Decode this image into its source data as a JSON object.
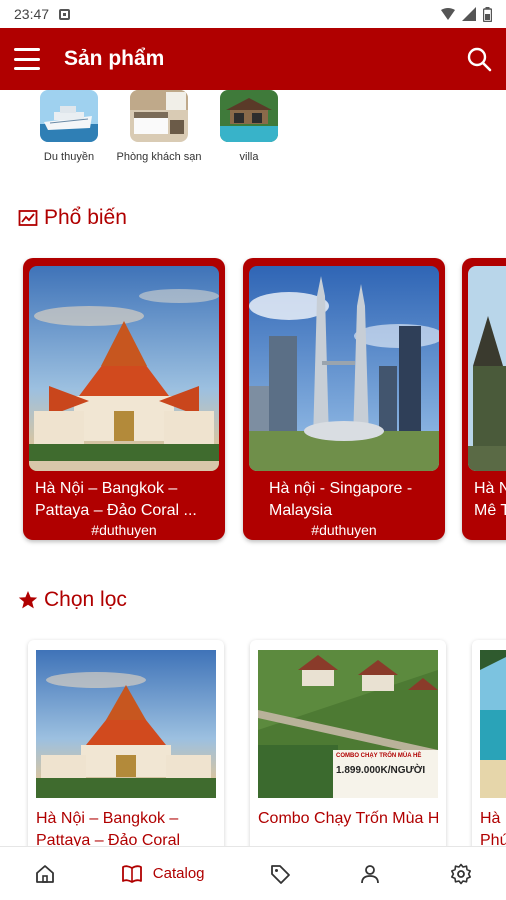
{
  "status_bar": {
    "time": "23:47"
  },
  "app_bar": {
    "title": "Sản phẩm",
    "menu_icon": "hamburger-icon",
    "search_icon": "search-icon"
  },
  "categories": [
    {
      "label": "Du thuyền",
      "image": "cruise-ship"
    },
    {
      "label": "Phòng khách sạn",
      "image": "hotel-room"
    },
    {
      "label": "villa",
      "image": "villa-pool"
    }
  ],
  "popular": {
    "title": "Phổ biến",
    "icon": "chart-icon",
    "cards": [
      {
        "title": "Hà Nội – Bangkok – Pattaya – Đảo Coral ...",
        "tag": "#duthuyen",
        "image": "thai-temple"
      },
      {
        "title": "Hà nội - Singapore - Malaysia",
        "tag": "#duthuyen",
        "image": "kuala-lumpur-towers"
      },
      {
        "title": "Hà N",
        "title2": "Mê T",
        "tag": "",
        "image": "pagoda-sky"
      }
    ]
  },
  "chosen": {
    "title": "Chọn lọc",
    "icon": "star-icon",
    "cards": [
      {
        "title": "Hà Nội – Bangkok – Pattaya – Đảo Coral",
        "image": "thai-temple"
      },
      {
        "title": "Combo Chạy Trốn Mùa Hè Sapa Jade H",
        "image": "sapa-resort",
        "promo_title": "COMBO CHẠY TRỐN MÙA HÈ",
        "promo_price": "1.899.000K/NGƯỜI"
      },
      {
        "title": "Hà Phú",
        "image": "beach"
      }
    ]
  },
  "bottom_nav": [
    {
      "id": "home",
      "icon": "home-icon",
      "label": ""
    },
    {
      "id": "catalog",
      "icon": "book-icon",
      "label": "Catalog",
      "active": true
    },
    {
      "id": "tags",
      "icon": "tag-icon",
      "label": ""
    },
    {
      "id": "account",
      "icon": "person-icon",
      "label": ""
    },
    {
      "id": "settings",
      "icon": "gear-icon",
      "label": ""
    }
  ],
  "colors": {
    "primary": "#b00000",
    "surface": "#ffffff",
    "text": "#333333"
  }
}
